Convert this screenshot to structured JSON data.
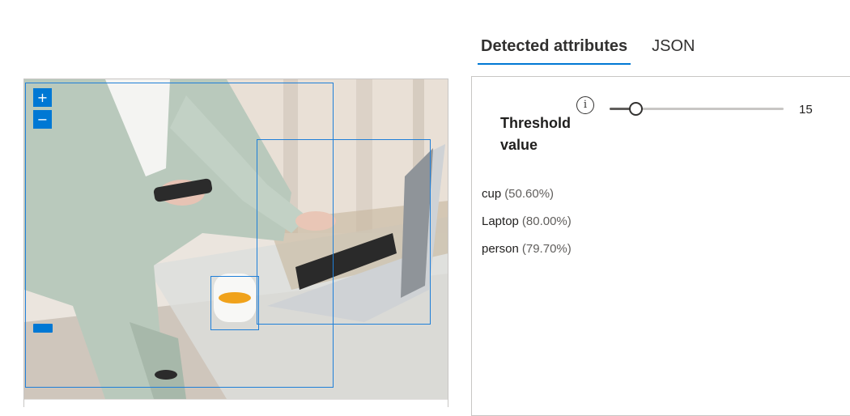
{
  "tabs": [
    {
      "label": "Detected attributes",
      "active": true
    },
    {
      "label": "JSON",
      "active": false
    }
  ],
  "zoom": {
    "in_label": "+",
    "out_label": "−"
  },
  "threshold": {
    "label": "Threshold value",
    "info_icon": "info-icon",
    "value": 15,
    "max": 100
  },
  "attributes": [
    {
      "name": "cup",
      "confidence": "(50.60%)"
    },
    {
      "name": "Laptop",
      "confidence": "(80.00%)"
    },
    {
      "name": "person",
      "confidence": "(79.70%)"
    }
  ],
  "colors": {
    "accent": "#0078d4",
    "bbox": "#1f7fd8"
  }
}
